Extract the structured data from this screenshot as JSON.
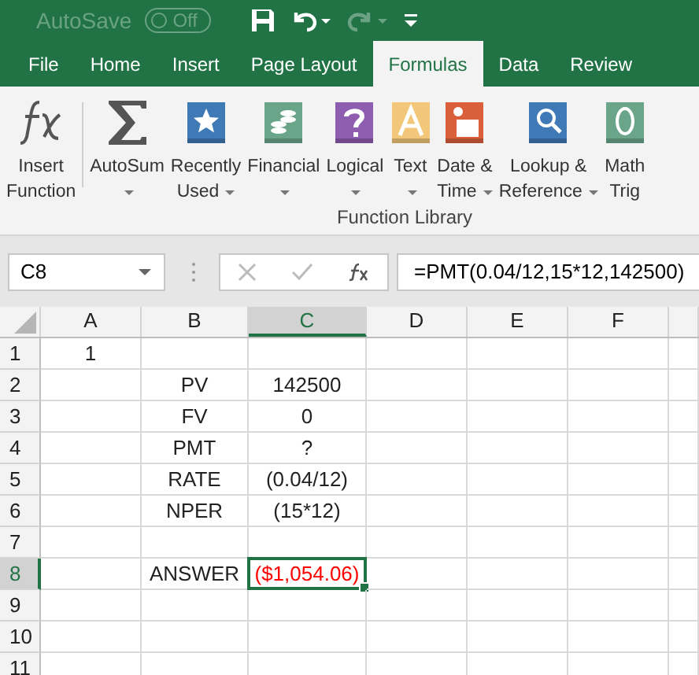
{
  "title_bar": {
    "autosave_label": "AutoSave",
    "autosave_toggle": {
      "label": "Off",
      "on": false
    }
  },
  "tabs": [
    {
      "label": "File",
      "selected": false
    },
    {
      "label": "Home",
      "selected": false
    },
    {
      "label": "Insert",
      "selected": false
    },
    {
      "label": "Page Layout",
      "selected": false
    },
    {
      "label": "Formulas",
      "selected": true
    },
    {
      "label": "Data",
      "selected": false
    },
    {
      "label": "Review",
      "selected": false
    }
  ],
  "ribbon": {
    "buttons": [
      {
        "kind": "fx",
        "lines": [
          "Insert",
          "Function"
        ]
      },
      {
        "kind": "sigma",
        "lines": [
          "AutoSum"
        ],
        "dropdown": true,
        "caret_inline": false
      },
      {
        "kind": "star",
        "lines": [
          "Recently",
          "Used"
        ],
        "dropdown": true,
        "caret_inline": true
      },
      {
        "kind": "coins",
        "lines": [
          "Financial"
        ],
        "dropdown": true,
        "caret_inline": false
      },
      {
        "kind": "question",
        "lines": [
          "Logical"
        ],
        "dropdown": true,
        "caret_inline": false
      },
      {
        "kind": "letter",
        "lines": [
          "Text"
        ],
        "dropdown": true,
        "caret_inline": false
      },
      {
        "kind": "calendar",
        "lines": [
          "Date &",
          "Time"
        ],
        "dropdown": true,
        "caret_inline": true
      },
      {
        "kind": "lookup",
        "lines": [
          "Lookup &",
          "Reference"
        ],
        "dropdown": true,
        "caret_inline": true
      },
      {
        "kind": "theta",
        "lines": [
          "Math",
          "Trig"
        ]
      }
    ],
    "group_label": "Function Library"
  },
  "formula_bar": {
    "name_box": "C8",
    "formula": "=PMT(0.04/12,15*12,142500)"
  },
  "sheet": {
    "columns": [
      {
        "label": "A",
        "selected": false
      },
      {
        "label": "B",
        "selected": false
      },
      {
        "label": "C",
        "selected": true
      },
      {
        "label": "D",
        "selected": false
      },
      {
        "label": "E",
        "selected": false
      },
      {
        "label": "F",
        "selected": false
      }
    ],
    "rows": [
      {
        "number": "1",
        "selected": false,
        "a": "1"
      },
      {
        "number": "2",
        "selected": false,
        "b": "PV",
        "c": "142500"
      },
      {
        "number": "3",
        "selected": false,
        "b": "FV",
        "c": "0"
      },
      {
        "number": "4",
        "selected": false,
        "b": "PMT",
        "c": "?"
      },
      {
        "number": "5",
        "selected": false,
        "b": "RATE",
        "c": "(0.04/12)"
      },
      {
        "number": "6",
        "selected": false,
        "b": "NPER",
        "c": "(15*12)"
      },
      {
        "number": "7",
        "selected": false
      },
      {
        "number": "8",
        "selected": true,
        "b": "ANSWER",
        "c": "($1,054.06)",
        "c_negative": true
      },
      {
        "number": "9",
        "selected": false
      },
      {
        "number": "10",
        "selected": false
      },
      {
        "number": "11",
        "selected": false
      }
    ]
  }
}
